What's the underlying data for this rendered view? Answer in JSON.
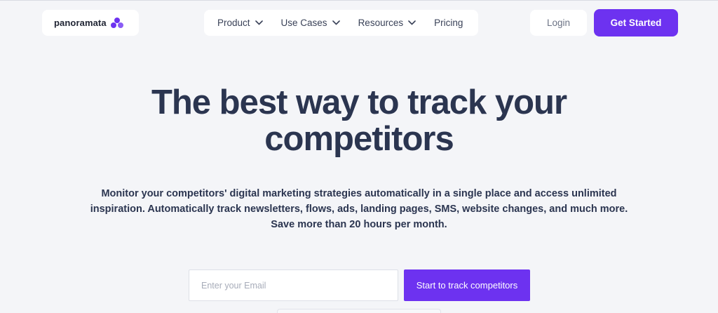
{
  "brand": {
    "name": "panoramata",
    "logo_icon": "three-dots-cluster-icon",
    "accent_color": "#6d32f0"
  },
  "nav": {
    "items": [
      {
        "label": "Product",
        "has_dropdown": true
      },
      {
        "label": "Use Cases",
        "has_dropdown": true
      },
      {
        "label": "Resources",
        "has_dropdown": true
      },
      {
        "label": "Pricing",
        "has_dropdown": false
      }
    ],
    "dropdown_icon": "chevron-down-icon"
  },
  "header_actions": {
    "login_label": "Login",
    "get_started_label": "Get Started"
  },
  "hero": {
    "title_line1": "The best way to track your",
    "title_line2": "competitors",
    "subtitle": "Monitor your competitors' digital marketing strategies automatically in a single place and access unlimited inspiration. Automatically track newsletters, flows, ads, landing pages, SMS, website changes, and much more. Save more than 20 hours per month."
  },
  "signup": {
    "email_placeholder": "Enter your Email",
    "email_value": "",
    "submit_label": "Start to track competitors"
  }
}
